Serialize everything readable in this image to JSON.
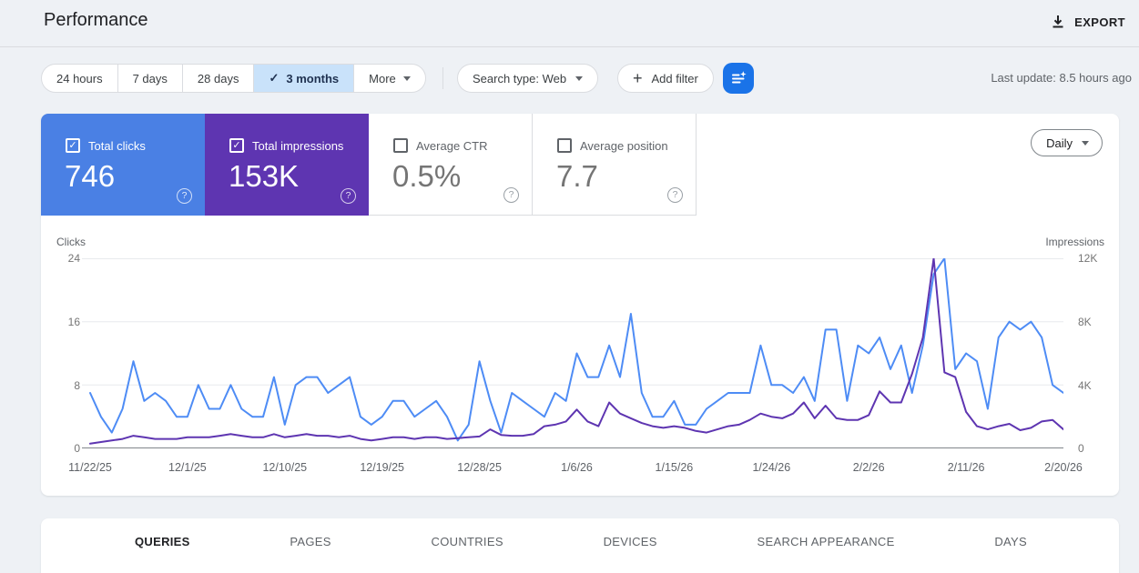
{
  "header": {
    "title": "Performance",
    "export_label": "EXPORT"
  },
  "toolbar": {
    "range_buttons": [
      {
        "label": "24 hours",
        "selected": false,
        "caret": false
      },
      {
        "label": "7 days",
        "selected": false,
        "caret": false
      },
      {
        "label": "28 days",
        "selected": false,
        "caret": false
      },
      {
        "label": "3 months",
        "selected": true,
        "caret": false
      },
      {
        "label": "More",
        "selected": false,
        "caret": true
      }
    ],
    "search_type": "Search type: Web",
    "add_filter_label": "Add filter",
    "last_update": "Last update: 8.5 hours ago"
  },
  "metrics": [
    {
      "label": "Total clicks",
      "value": "746",
      "checked": true,
      "style": "blue"
    },
    {
      "label": "Total impressions",
      "value": "153K",
      "checked": true,
      "style": "purple"
    },
    {
      "label": "Average CTR",
      "value": "0.5%",
      "checked": false,
      "style": "plain"
    },
    {
      "label": "Average position",
      "value": "7.7",
      "checked": false,
      "style": "plain"
    }
  ],
  "granularity": {
    "label": "Daily"
  },
  "colors": {
    "blue_tile": "#4a80e4",
    "purple_tile": "#5e35b1",
    "clicks_line": "#4e8cf5",
    "impressions_line": "#5e35b1",
    "selected_chip_bg": "#c9e2fa",
    "ai_button": "#1a73e8",
    "gridline": "#e8eaed",
    "axis_line": "#80868b"
  },
  "chart_data": {
    "type": "line",
    "title": "",
    "ylabel_left": "Clicks",
    "ylabel_right": "Impressions",
    "ylim_left": [
      0,
      24
    ],
    "ylim_right": [
      0,
      12000
    ],
    "yticks_left": [
      "24",
      "16",
      "8",
      "0"
    ],
    "yticks_right": [
      "12K",
      "8K",
      "4K",
      "0"
    ],
    "grid": true,
    "x_ticks": [
      {
        "day": 0,
        "label": "11/22/25"
      },
      {
        "day": 9,
        "label": "12/1/25"
      },
      {
        "day": 18,
        "label": "12/10/25"
      },
      {
        "day": 27,
        "label": "12/19/25"
      },
      {
        "day": 36,
        "label": "12/28/25"
      },
      {
        "day": 45,
        "label": "1/6/26"
      },
      {
        "day": 54,
        "label": "1/15/26"
      },
      {
        "day": 63,
        "label": "1/24/26"
      },
      {
        "day": 72,
        "label": "2/2/26"
      },
      {
        "day": 81,
        "label": "2/11/26"
      },
      {
        "day": 90,
        "label": "2/20/26"
      }
    ],
    "series": [
      {
        "name": "Clicks",
        "axis": "left",
        "values": [
          7,
          4,
          2,
          5,
          11,
          6,
          7,
          6,
          4,
          4,
          8,
          5,
          5,
          8,
          5,
          4,
          4,
          9,
          3,
          8,
          9,
          9,
          7,
          8,
          9,
          4,
          3,
          4,
          6,
          6,
          4,
          5,
          6,
          4,
          1,
          3,
          11,
          6,
          2,
          7,
          6,
          5,
          4,
          7,
          6,
          12,
          9,
          9,
          13,
          9,
          17,
          7,
          4,
          4,
          6,
          3,
          3,
          5,
          6,
          7,
          7,
          7,
          13,
          8,
          8,
          7,
          9,
          6,
          15,
          15,
          6,
          13,
          12,
          14,
          10,
          13,
          7,
          13,
          22,
          24,
          10,
          12,
          11,
          5,
          14,
          16,
          15,
          16,
          14,
          8,
          7
        ]
      },
      {
        "name": "Impressions",
        "axis": "right",
        "values": [
          300,
          400,
          500,
          600,
          800,
          700,
          600,
          600,
          600,
          700,
          700,
          700,
          800,
          900,
          800,
          700,
          700,
          900,
          700,
          800,
          900,
          800,
          800,
          700,
          800,
          600,
          500,
          600,
          700,
          700,
          600,
          700,
          700,
          600,
          650,
          700,
          750,
          1200,
          850,
          800,
          800,
          900,
          1400,
          1500,
          1700,
          2450,
          1700,
          1400,
          2900,
          2200,
          1900,
          1600,
          1400,
          1300,
          1400,
          1300,
          1100,
          1000,
          1200,
          1400,
          1500,
          1800,
          2200,
          2000,
          1900,
          2200,
          2900,
          1900,
          2700,
          1900,
          1800,
          1800,
          2100,
          3600,
          2900,
          2900,
          4700,
          7000,
          12000,
          4800,
          4500,
          2300,
          1400,
          1200,
          1400,
          1550,
          1150,
          1300,
          1700,
          1800,
          1200
        ]
      }
    ]
  },
  "tabs": [
    {
      "label": "QUERIES",
      "active": true
    },
    {
      "label": "PAGES",
      "active": false
    },
    {
      "label": "COUNTRIES",
      "active": false
    },
    {
      "label": "DEVICES",
      "active": false
    },
    {
      "label": "SEARCH APPEARANCE",
      "active": false
    },
    {
      "label": "DAYS",
      "active": false
    }
  ]
}
